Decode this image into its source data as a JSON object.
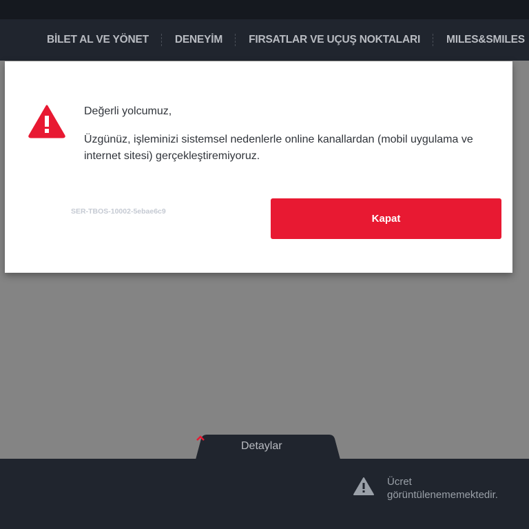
{
  "nav": {
    "items": [
      {
        "label": "BİLET AL VE YÖNET"
      },
      {
        "label": "DENEYİM"
      },
      {
        "label": "FIRSATLAR VE UÇUŞ NOKTALARI"
      },
      {
        "label": "MILES&SMILES"
      }
    ]
  },
  "modal": {
    "icon": "warning-triangle-icon",
    "greeting": "Değerli yolcumuz,",
    "message": "Üzgünüz, işleminizi sistemsel nedenlerle online kanallardan (mobil uygulama ve internet sitesi) gerçekleştiremiyoruz.",
    "error_code": "SER-TBOS-10002-5ebae6c9",
    "close_label": "Kapat"
  },
  "footer": {
    "details_label": "Detaylar",
    "price_message": "Ücret görüntülenememektedir."
  },
  "colors": {
    "accent_red": "#e81932",
    "nav_bg": "#20252e",
    "overlay": "#848484"
  }
}
